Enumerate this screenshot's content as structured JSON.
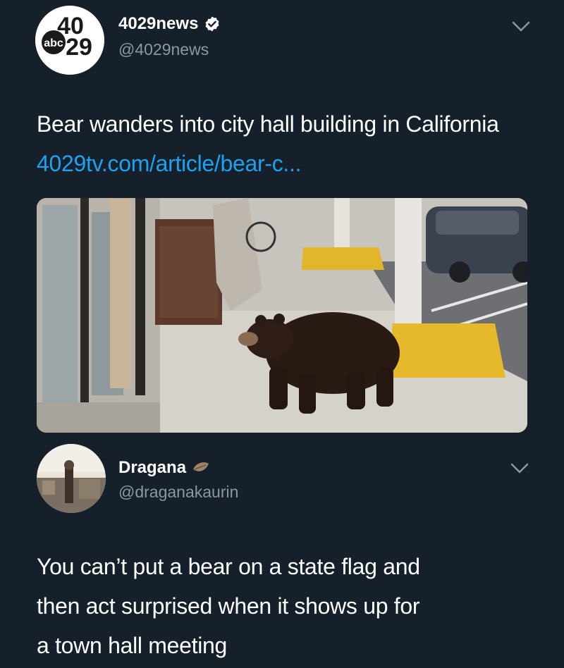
{
  "tweets": [
    {
      "display_name": "4029news",
      "handle": "@4029news",
      "verified": true,
      "avatar_logo": {
        "line1": "40",
        "brand": "abc",
        "line2": "29"
      },
      "text": "Bear wanders into city hall building in California ",
      "link_text": "4029tv.com/article/bear-c...",
      "media": "bear-photo",
      "colors": {
        "link": "#1da1f2",
        "verified": "#ffffff"
      }
    },
    {
      "display_name": "Dragana",
      "name_icon": "leaf-icon",
      "handle": "@draganakaurin",
      "text_line1": "You can’t put a bear on a state flag and",
      "text_line2": "then act surprised when it shows up for",
      "text_line3": "a town hall meeting"
    }
  ],
  "theme": {
    "background": "#15202b",
    "secondary_text": "#8899a6"
  }
}
